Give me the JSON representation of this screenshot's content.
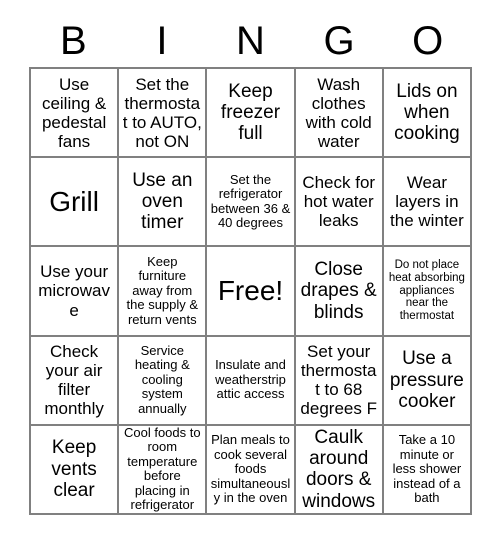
{
  "card": {
    "title": "BINGO",
    "header_letters": [
      "B",
      "I",
      "N",
      "G",
      "O"
    ],
    "grid_size": 5,
    "free_space_label": "Free!",
    "colors": {
      "background": "#ffffff",
      "cell_background": "#ffffff",
      "border": "#808080",
      "text": "#000000"
    },
    "rows": [
      [
        {
          "text": "Use ceiling & pedestal fans",
          "size": "md"
        },
        {
          "text": "Set the thermostat to AUTO, not ON",
          "size": "md"
        },
        {
          "text": "Keep freezer full",
          "size": "lg"
        },
        {
          "text": "Wash clothes with cold water",
          "size": "md"
        },
        {
          "text": "Lids on when cooking",
          "size": "lg"
        }
      ],
      [
        {
          "text": "Grill",
          "size": "xl"
        },
        {
          "text": "Use an oven timer",
          "size": "lg"
        },
        {
          "text": "Set the refrigerator between 36 & 40 degrees",
          "size": "sm"
        },
        {
          "text": "Check for hot water leaks",
          "size": "md"
        },
        {
          "text": "Wear layers in the winter",
          "size": "md"
        }
      ],
      [
        {
          "text": "Use your microwave",
          "size": "md"
        },
        {
          "text": "Keep furniture away from the supply & return vents",
          "size": "sm"
        },
        {
          "text": "Free!",
          "size": "xl"
        },
        {
          "text": "Close drapes & blinds",
          "size": "lg"
        },
        {
          "text": "Do not place heat absorbing appliances near the thermostat",
          "size": "xs"
        }
      ],
      [
        {
          "text": "Check your air filter monthly",
          "size": "md"
        },
        {
          "text": "Service heating & cooling system annually",
          "size": "sm"
        },
        {
          "text": "Insulate and weatherstrip attic access",
          "size": "sm"
        },
        {
          "text": "Set your thermostat to 68 degrees F",
          "size": "md"
        },
        {
          "text": "Use a pressure cooker",
          "size": "lg"
        }
      ],
      [
        {
          "text": "Keep vents clear",
          "size": "lg"
        },
        {
          "text": "Cool foods to room temperature before placing in refrigerator",
          "size": "sm"
        },
        {
          "text": "Plan meals to cook several foods simultaneously in the oven",
          "size": "sm"
        },
        {
          "text": "Caulk around doors & windows",
          "size": "lg"
        },
        {
          "text": "Take a 10 minute or less shower instead of a bath",
          "size": "sm"
        }
      ]
    ]
  }
}
